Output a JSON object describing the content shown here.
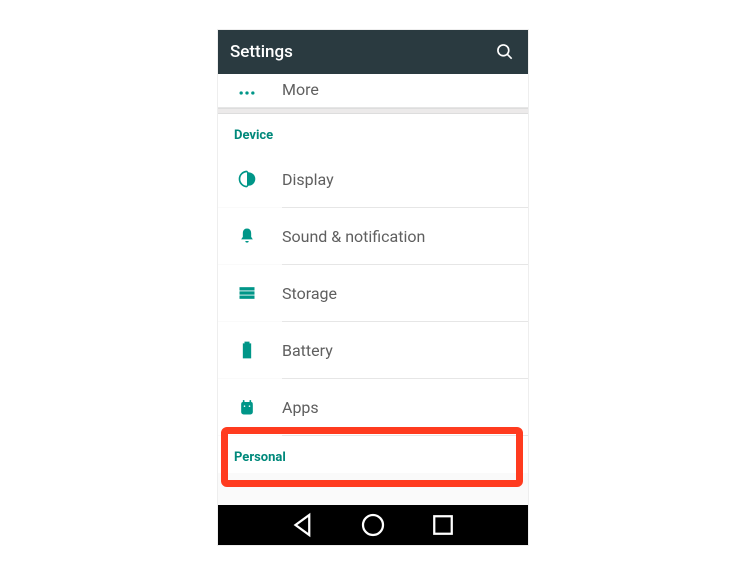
{
  "appbar": {
    "title": "Settings"
  },
  "topItem": {
    "label": "More",
    "icon": "more-icon"
  },
  "sections": {
    "device": {
      "header": "Device",
      "items": [
        {
          "label": "Display",
          "icon": "display-icon"
        },
        {
          "label": "Sound & notification",
          "icon": "bell-icon"
        },
        {
          "label": "Storage",
          "icon": "storage-icon"
        },
        {
          "label": "Battery",
          "icon": "battery-icon"
        },
        {
          "label": "Apps",
          "icon": "apps-icon"
        }
      ]
    },
    "personal": {
      "header": "Personal"
    }
  },
  "highlightedItem": "Apps",
  "colors": {
    "accent": "#009688",
    "appbar": "#2a3a40",
    "highlight": "#ff3b1f"
  }
}
